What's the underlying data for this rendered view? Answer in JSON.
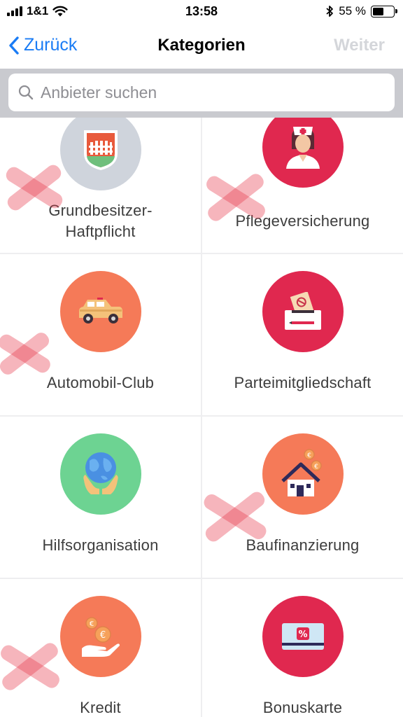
{
  "status_bar": {
    "carrier": "1&1",
    "time": "13:58",
    "battery_percent": "55 %",
    "battery_level": 0.55
  },
  "nav": {
    "back_label": "Zurück",
    "title": "Kategorien",
    "next_label": "Weiter"
  },
  "search": {
    "placeholder": "Anbieter suchen",
    "value": ""
  },
  "colors": {
    "accent": "#1a7cf5",
    "gray": "#cfd4dc",
    "red": "#e0284f",
    "orange": "#f57a58",
    "green": "#6dd392"
  },
  "categories": [
    {
      "label_line1": "Grundbesitzer-",
      "label_line2": "Haftpflicht",
      "icon": "shield-fence-icon"
    },
    {
      "label": "Pflegeversicherung",
      "icon": "nurse-icon"
    },
    {
      "label": "Automobil-Club",
      "icon": "car-icon"
    },
    {
      "label": "Parteimitgliedschaft",
      "icon": "ballot-box-icon"
    },
    {
      "label": "Hilfsorganisation",
      "icon": "globe-hands-icon"
    },
    {
      "label": "Baufinanzierung",
      "icon": "house-coins-icon"
    },
    {
      "label": "Kredit",
      "icon": "hand-coins-icon"
    },
    {
      "label": "Bonuskarte",
      "icon": "bonus-card-icon"
    }
  ]
}
